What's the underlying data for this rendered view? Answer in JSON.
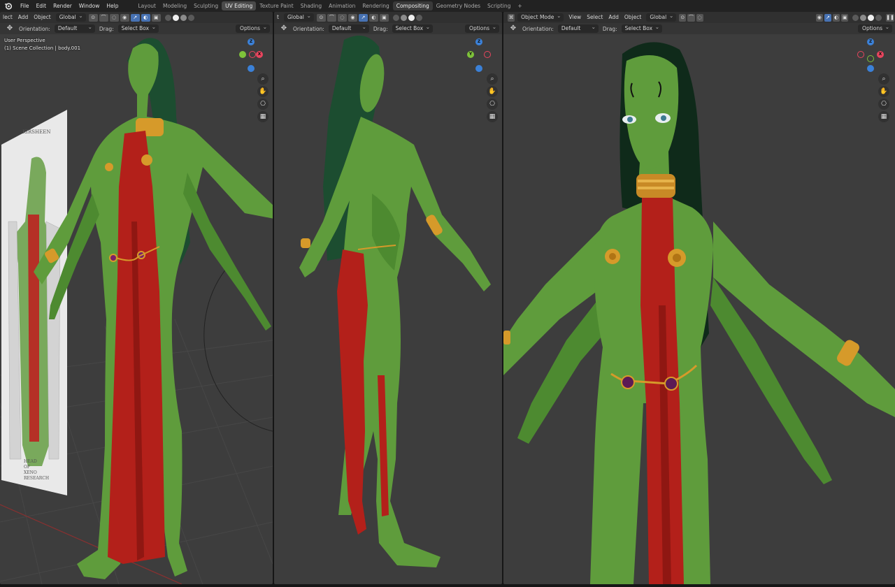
{
  "topbar": {
    "menus": [
      "File",
      "Edit",
      "Render",
      "Window",
      "Help"
    ],
    "workspaces": [
      "Layout",
      "Modeling",
      "Sculpting",
      "UV Editing",
      "Texture Paint",
      "Shading",
      "Animation",
      "Rendering",
      "Compositing",
      "Geometry Nodes",
      "Scripting",
      "+"
    ],
    "active_workspace": "UV Editing"
  },
  "viewport_left": {
    "header": {
      "select_cut": "lect",
      "add": "Add",
      "object": "Object",
      "transform_orientation": "Global"
    },
    "tool": {
      "orientation_label": "Orientation:",
      "orientation_value": "Default",
      "drag_label": "Drag:",
      "drag_value": "Select Box",
      "options": "Options"
    },
    "overlay_line1": "User Perspective",
    "overlay_line2": "(1) Scene Collection | body.001",
    "reference_title": "KIRSHEEN",
    "reference_caption": [
      "HEAD",
      "OF",
      "XENO",
      "RESEARCH"
    ]
  },
  "viewport_middle": {
    "header": {
      "select_cut": "t",
      "transform_orientation": "Global"
    },
    "tool": {
      "orientation_label": "Orientation:",
      "orientation_value": "Default",
      "drag_label": "Drag:",
      "drag_value": "Select Box",
      "options": "Options"
    }
  },
  "viewport_right": {
    "header": {
      "mode": "Object Mode",
      "view": "View",
      "select": "Select",
      "add": "Add",
      "object": "Object",
      "transform_orientation": "Global"
    },
    "tool": {
      "orientation_label": "Orientation:",
      "orientation_value": "Default",
      "drag_label": "Drag:",
      "drag_value": "Select Box",
      "options": "Options"
    }
  },
  "gizmo_labels": {
    "x": "X",
    "y": "Y",
    "z": "Z"
  },
  "colors": {
    "skin": "#5f9c3c",
    "skin_shadow": "#3f7426",
    "cloth_red": "#b3201a",
    "gold": "#d69a2a",
    "hair": "#1c4d30",
    "viewport_bg": "#3d3d3d",
    "accent": "#4772b3"
  },
  "icons": [
    "blender-logo-icon",
    "move-icon",
    "zoom-icon",
    "hand-icon",
    "camera-icon",
    "grid-icon"
  ]
}
